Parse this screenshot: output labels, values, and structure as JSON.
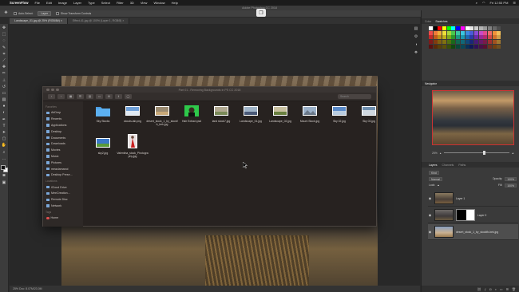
{
  "menubar": {
    "app": "ScreenFlow",
    "items": [
      "File",
      "Edit",
      "Image",
      "Layer",
      "Type",
      "Select",
      "Filter",
      "3D",
      "View",
      "Window",
      "Help"
    ],
    "clock": "Fri 12:53 PM"
  },
  "ps": {
    "title": "Adobe Photoshop CC 2018"
  },
  "options": {
    "auto_select": "Auto-Select:",
    "auto_select_value": "Layer",
    "show_transform": "Show Transform Controls"
  },
  "tabs": [
    {
      "label": "Landscape_01.jpg @ 25% (RGB/8#) ×",
      "active": true
    },
    {
      "label": "Effect-41.jpg @ 100% (Layer 1, RGB/8) ×",
      "active": false
    }
  ],
  "status": "25%   Doc: 8.07M/23.0M",
  "finder": {
    "title": "Part 01 - Removing Backgrounds in PS CC 2018",
    "search": "Search",
    "sidebar": {
      "favorites_heading": "Favorites",
      "favorites": [
        "AirDrop",
        "Recents",
        "Applications",
        "Desktop",
        "Documents",
        "Downloads",
        "Movies",
        "Music",
        "Pictures",
        "meaclamanol",
        "Desktop Prese..."
      ],
      "locations_heading": "Locations",
      "locations": [
        "iCloud Drive",
        "MeeCreation...",
        "Remote Disc",
        "Network"
      ],
      "tags_heading": "Tags",
      "tags": [
        "Home"
      ]
    },
    "files": [
      {
        "name": "Sky Stocks",
        "kind": "folder"
      },
      {
        "name": "clouds-lab.png",
        "kind": "sky"
      },
      {
        "name": "desert_stock_1_by_stockfb_bek.jpg",
        "kind": "desert"
      },
      {
        "name": "Hair Extract.psd",
        "kind": "portrait"
      },
      {
        "name": "land stock7.jpg",
        "kind": "land"
      },
      {
        "name": "Landscape_01.jpg",
        "kind": "land2"
      },
      {
        "name": "Landscape_02.jpg",
        "kind": "land3"
      },
      {
        "name": "Mount Stock.jpg",
        "kind": "mount"
      },
      {
        "name": "Sky 02.jpg",
        "kind": "sky2"
      },
      {
        "name": "Sky 03.jpg",
        "kind": "sky3"
      },
      {
        "name": "sky2.jpg",
        "kind": "sky4"
      },
      {
        "name": "Valentina_stock_Photography.jpg",
        "kind": "woman"
      }
    ]
  },
  "panels": {
    "color_tabs": [
      "Color",
      "Swatches"
    ],
    "navigator": "Navigator",
    "zoom": "25%",
    "layers_tabs": [
      "Layers",
      "Channels",
      "Paths"
    ],
    "kind": "Kind",
    "blend_mode": "Normal",
    "opacity_label": "Opacity:",
    "opacity": "100%",
    "lock_label": "Lock:",
    "fill_label": "Fill:",
    "fill": "100%",
    "layers": [
      {
        "name": "Layer 1",
        "selected": false,
        "mask": false
      },
      {
        "name": "Layer 0",
        "selected": false,
        "mask": true
      },
      {
        "name": "desert_stock_1_by_stockfb-bek.jpg",
        "selected": true,
        "mask": false
      }
    ]
  },
  "colors": {
    "swatches": [
      "#ffffff",
      "#000000",
      "#ff0000",
      "#ffff00",
      "#00ff00",
      "#00ffff",
      "#0000ff",
      "#ff00ff",
      "#ffffff",
      "#e6e6e6",
      "#cccccc",
      "#b3b3b3",
      "#999999",
      "#808080",
      "#666666",
      "#4d4d4d",
      "#f04a4a",
      "#f07a3a",
      "#f0b03a",
      "#f0e03a",
      "#a8d83a",
      "#4ac84a",
      "#3ac8a0",
      "#3ac8e0",
      "#3a8ae0",
      "#4a5ad8",
      "#8a4ad8",
      "#c84ac8",
      "#e04a90",
      "#f06a6a",
      "#f0903a",
      "#f0c05a",
      "#c02a2a",
      "#c05a1a",
      "#c0901a",
      "#c0b01a",
      "#80a81a",
      "#2a982a",
      "#1a9880",
      "#1a98b0",
      "#1a6ab0",
      "#2a3aa8",
      "#6a2aa8",
      "#982a98",
      "#b02a70",
      "#d04a4a",
      "#d0702a",
      "#d0a04a",
      "#801a1a",
      "#803a10",
      "#806010",
      "#807010",
      "#507010",
      "#1a681a",
      "#106850",
      "#106878",
      "#104878",
      "#1a2878",
      "#481a78",
      "#681a68",
      "#781a48",
      "#a03030",
      "#a05020",
      "#a07830",
      "#5a1010",
      "#5a2a08",
      "#5a4008",
      "#5a5008",
      "#385008",
      "#104810",
      "#084838",
      "#084858",
      "#083058",
      "#101858",
      "#301058",
      "#481048",
      "#581030",
      "#703020",
      "#704010",
      "#705020"
    ]
  }
}
